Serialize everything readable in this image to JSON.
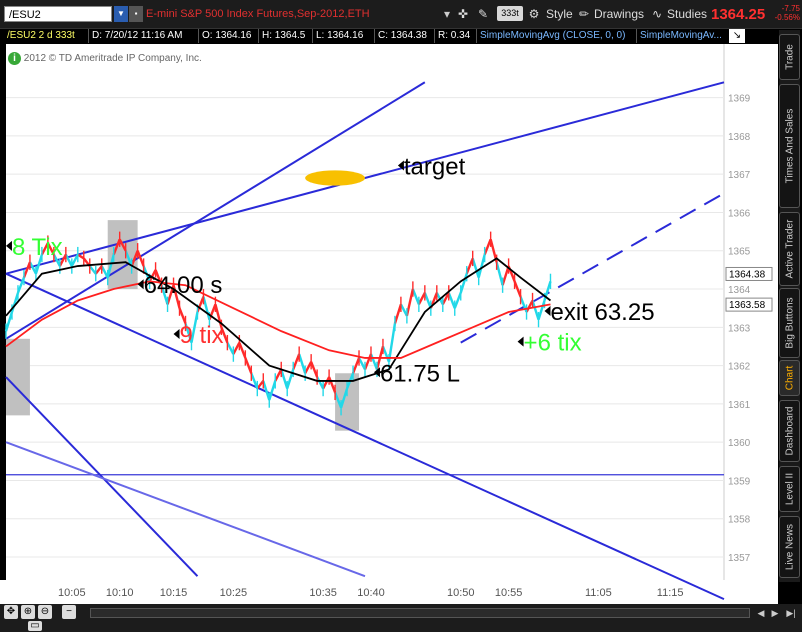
{
  "toolbar": {
    "symbol": "/ESU2",
    "symbol_title": "E-mini S&P 500 Index Futures,Sep-2012,ETH",
    "timeframe": "333t",
    "style_label": "Style",
    "drawings_label": "Drawings",
    "studies_label": "Studies",
    "last_price": "1364.25",
    "change": "-7.75",
    "change_pct": "-0.56%"
  },
  "infobar": {
    "symbol_period": "/ESU2 2 d 333t",
    "date": "D: 7/20/12 11:16 AM",
    "open": "O: 1364.16",
    "high": "H: 1364.5",
    "low": "L: 1364.16",
    "close": "C: 1364.38",
    "range": "R: 0.34",
    "study1": "SimpleMovingAvg (CLOSE, 0, 0)",
    "study2": "SimpleMovingAv..."
  },
  "copyright": "2012 © TD Ameritrade IP Company, Inc.",
  "side_tabs": [
    "Trade",
    "Times And Sales",
    "Active Trader",
    "Big Buttons",
    "Chart",
    "Dashboard",
    "Level II",
    "Live News"
  ],
  "side_tab_active": "Chart",
  "chart_data": {
    "type": "line",
    "x_tick_labels": [
      "10:05",
      "10:10",
      "10:15",
      "10:25",
      "10:35",
      "10:40",
      "10:50",
      "10:55",
      "11:05",
      "11:15"
    ],
    "y_ticks": [
      1357,
      1358,
      1359,
      1360,
      1361,
      1362,
      1363,
      1364,
      1365,
      1366,
      1367,
      1368,
      1369
    ],
    "ylim": [
      1356.4,
      1370.4
    ],
    "xlim": [
      0,
      120
    ],
    "tick_positions": [
      11,
      19,
      28,
      38,
      53,
      61,
      76,
      84,
      99,
      111
    ],
    "price_labels": [
      {
        "value": 1364.38,
        "text": "1364.38",
        "color": "#ffffff",
        "text_color": "#000000"
      },
      {
        "value": 1363.58,
        "text": "1363.58",
        "color": "#ffffff",
        "text_color": "#000000"
      }
    ],
    "horizontal_line": 1359.15,
    "series": [
      {
        "name": "price",
        "color": "#22d8e8",
        "alt_color": "#ff2a2a",
        "values": [
          [
            0,
            1362.9,
            0
          ],
          [
            1,
            1363.4,
            0
          ],
          [
            2,
            1363.9,
            0
          ],
          [
            3,
            1364.3,
            0
          ],
          [
            4,
            1364.7,
            1
          ],
          [
            5,
            1364.4,
            0
          ],
          [
            6,
            1364.9,
            0
          ],
          [
            7,
            1365.2,
            1
          ],
          [
            8,
            1364.9,
            1
          ],
          [
            9,
            1364.6,
            0
          ],
          [
            10,
            1364.9,
            1
          ],
          [
            11,
            1364.6,
            0
          ],
          [
            12,
            1364.9,
            0
          ],
          [
            13,
            1364.8,
            1
          ],
          [
            14,
            1364.6,
            1
          ],
          [
            15,
            1364.4,
            0
          ],
          [
            16,
            1364.6,
            1
          ],
          [
            17,
            1364.3,
            0
          ],
          [
            18,
            1364.9,
            0
          ],
          [
            19,
            1365.3,
            1
          ],
          [
            20,
            1365.0,
            1
          ],
          [
            21,
            1364.6,
            0
          ],
          [
            22,
            1365.0,
            1
          ],
          [
            23,
            1364.6,
            1
          ],
          [
            24,
            1364.2,
            0
          ],
          [
            25,
            1364.5,
            1
          ],
          [
            26,
            1364.1,
            1
          ],
          [
            27,
            1363.6,
            0
          ],
          [
            28,
            1364.1,
            1
          ],
          [
            29,
            1363.5,
            1
          ],
          [
            30,
            1363.1,
            1
          ],
          [
            31,
            1362.6,
            0
          ],
          [
            32,
            1363.4,
            0
          ],
          [
            33,
            1363.8,
            1
          ],
          [
            34,
            1363.2,
            0
          ],
          [
            35,
            1363.6,
            1
          ],
          [
            36,
            1363.0,
            1
          ],
          [
            37,
            1362.6,
            1
          ],
          [
            38,
            1362.3,
            0
          ],
          [
            39,
            1362.6,
            1
          ],
          [
            40,
            1362.2,
            1
          ],
          [
            41,
            1361.8,
            1
          ],
          [
            42,
            1361.4,
            0
          ],
          [
            43,
            1361.6,
            1
          ],
          [
            44,
            1361.1,
            0
          ],
          [
            45,
            1361.6,
            0
          ],
          [
            46,
            1361.9,
            1
          ],
          [
            47,
            1361.4,
            0
          ],
          [
            48,
            1361.9,
            0
          ],
          [
            49,
            1362.3,
            1
          ],
          [
            50,
            1361.8,
            0
          ],
          [
            51,
            1362.1,
            1
          ],
          [
            52,
            1361.7,
            1
          ],
          [
            53,
            1361.4,
            0
          ],
          [
            54,
            1361.7,
            1
          ],
          [
            55,
            1361.3,
            1
          ],
          [
            56,
            1360.9,
            0
          ],
          [
            57,
            1361.4,
            0
          ],
          [
            58,
            1361.8,
            0
          ],
          [
            59,
            1362.2,
            1
          ],
          [
            60,
            1361.9,
            0
          ],
          [
            61,
            1362.3,
            1
          ],
          [
            62,
            1361.9,
            0
          ],
          [
            63,
            1362.5,
            1
          ],
          [
            64,
            1362.1,
            0
          ],
          [
            65,
            1363.1,
            0
          ],
          [
            66,
            1363.6,
            1
          ],
          [
            67,
            1363.3,
            0
          ],
          [
            68,
            1364.0,
            1
          ],
          [
            69,
            1363.6,
            0
          ],
          [
            70,
            1363.9,
            1
          ],
          [
            71,
            1363.5,
            0
          ],
          [
            72,
            1363.9,
            1
          ],
          [
            73,
            1363.6,
            0
          ],
          [
            74,
            1363.9,
            1
          ],
          [
            75,
            1363.5,
            0
          ],
          [
            76,
            1363.9,
            0
          ],
          [
            77,
            1364.4,
            0
          ],
          [
            78,
            1364.8,
            1
          ],
          [
            79,
            1364.3,
            0
          ],
          [
            80,
            1364.9,
            0
          ],
          [
            81,
            1365.3,
            1
          ],
          [
            82,
            1364.7,
            1
          ],
          [
            83,
            1364.1,
            0
          ],
          [
            84,
            1364.6,
            1
          ],
          [
            85,
            1364.2,
            1
          ],
          [
            86,
            1363.8,
            1
          ],
          [
            87,
            1363.4,
            0
          ],
          [
            88,
            1363.7,
            1
          ],
          [
            89,
            1363.2,
            0
          ],
          [
            90,
            1363.7,
            0
          ],
          [
            91,
            1364.2,
            0
          ]
        ]
      },
      {
        "name": "sma_fast",
        "color": "#000000",
        "values": [
          [
            0,
            1363.3
          ],
          [
            6,
            1364.4
          ],
          [
            12,
            1364.6
          ],
          [
            20,
            1364.7
          ],
          [
            28,
            1364.0
          ],
          [
            36,
            1363.1
          ],
          [
            44,
            1362.0
          ],
          [
            52,
            1361.6
          ],
          [
            58,
            1361.6
          ],
          [
            64,
            1361.9
          ],
          [
            70,
            1363.4
          ],
          [
            76,
            1364.2
          ],
          [
            82,
            1364.8
          ],
          [
            86,
            1364.3
          ],
          [
            91,
            1363.7
          ]
        ]
      },
      {
        "name": "sma_slow",
        "color": "#ff2020",
        "values": [
          [
            0,
            1362.5
          ],
          [
            6,
            1363.2
          ],
          [
            12,
            1363.7
          ],
          [
            18,
            1364.0
          ],
          [
            24,
            1364.2
          ],
          [
            30,
            1364.1
          ],
          [
            38,
            1363.5
          ],
          [
            46,
            1362.9
          ],
          [
            54,
            1362.4
          ],
          [
            60,
            1362.2
          ],
          [
            66,
            1362.2
          ],
          [
            72,
            1362.6
          ],
          [
            78,
            1363.0
          ],
          [
            84,
            1363.4
          ],
          [
            91,
            1363.6
          ]
        ]
      }
    ],
    "trend_lines": [
      {
        "from": [
          0,
          1364.4
        ],
        "to": [
          120,
          1369.4
        ],
        "color": "#2a2ad8",
        "dash": false
      },
      {
        "from": [
          0,
          1362.7
        ],
        "to": [
          70,
          1369.4
        ],
        "color": "#2a2ad8",
        "dash": false
      },
      {
        "from": [
          0,
          1364.4
        ],
        "to": [
          120,
          1355.9
        ],
        "color": "#2a2ad8",
        "dash": false
      },
      {
        "from": [
          0,
          1361.7
        ],
        "to": [
          32,
          1356.5
        ],
        "color": "#2a2ad8",
        "dash": false
      },
      {
        "from": [
          0,
          1360.0
        ],
        "to": [
          60,
          1356.5
        ],
        "color": "#6868e8",
        "dash": false
      },
      {
        "from": [
          76,
          1362.6
        ],
        "to": [
          120,
          1366.5
        ],
        "color": "#2a2ad8",
        "dash": true
      }
    ],
    "highlight_boxes": [
      {
        "x0": 0,
        "x1": 4,
        "y0": 1360.7,
        "y1": 1362.7
      },
      {
        "x0": 17,
        "x1": 22,
        "y0": 1364.0,
        "y1": 1365.8
      },
      {
        "x0": 55,
        "x1": 59,
        "y0": 1360.3,
        "y1": 1361.8
      }
    ],
    "target_ellipse": {
      "x": 55,
      "y": 1366.9,
      "rx": 5,
      "ry": 0.2,
      "color": "#f8c000"
    },
    "annotations": [
      {
        "text": "target",
        "x": 66.5,
        "y": 1367.2,
        "color": "#000000",
        "size": 24
      },
      {
        "text": "8 Tix",
        "x": 1,
        "y": 1365.1,
        "color": "#33ff33",
        "size": 24
      },
      {
        "text": "64.00 s",
        "x": 23,
        "y": 1364.1,
        "color": "#000000",
        "size": 24
      },
      {
        "text": "9 tix",
        "x": 29,
        "y": 1362.8,
        "color": "#ff3030",
        "size": 24
      },
      {
        "text": "61.75 L",
        "x": 62.5,
        "y": 1361.8,
        "color": "#000000",
        "size": 24
      },
      {
        "text": "exit 63.25",
        "x": 91,
        "y": 1363.4,
        "color": "#000000",
        "size": 24
      },
      {
        "text": "+6 tix",
        "x": 86.5,
        "y": 1362.6,
        "color": "#33ff33",
        "size": 24
      }
    ]
  }
}
